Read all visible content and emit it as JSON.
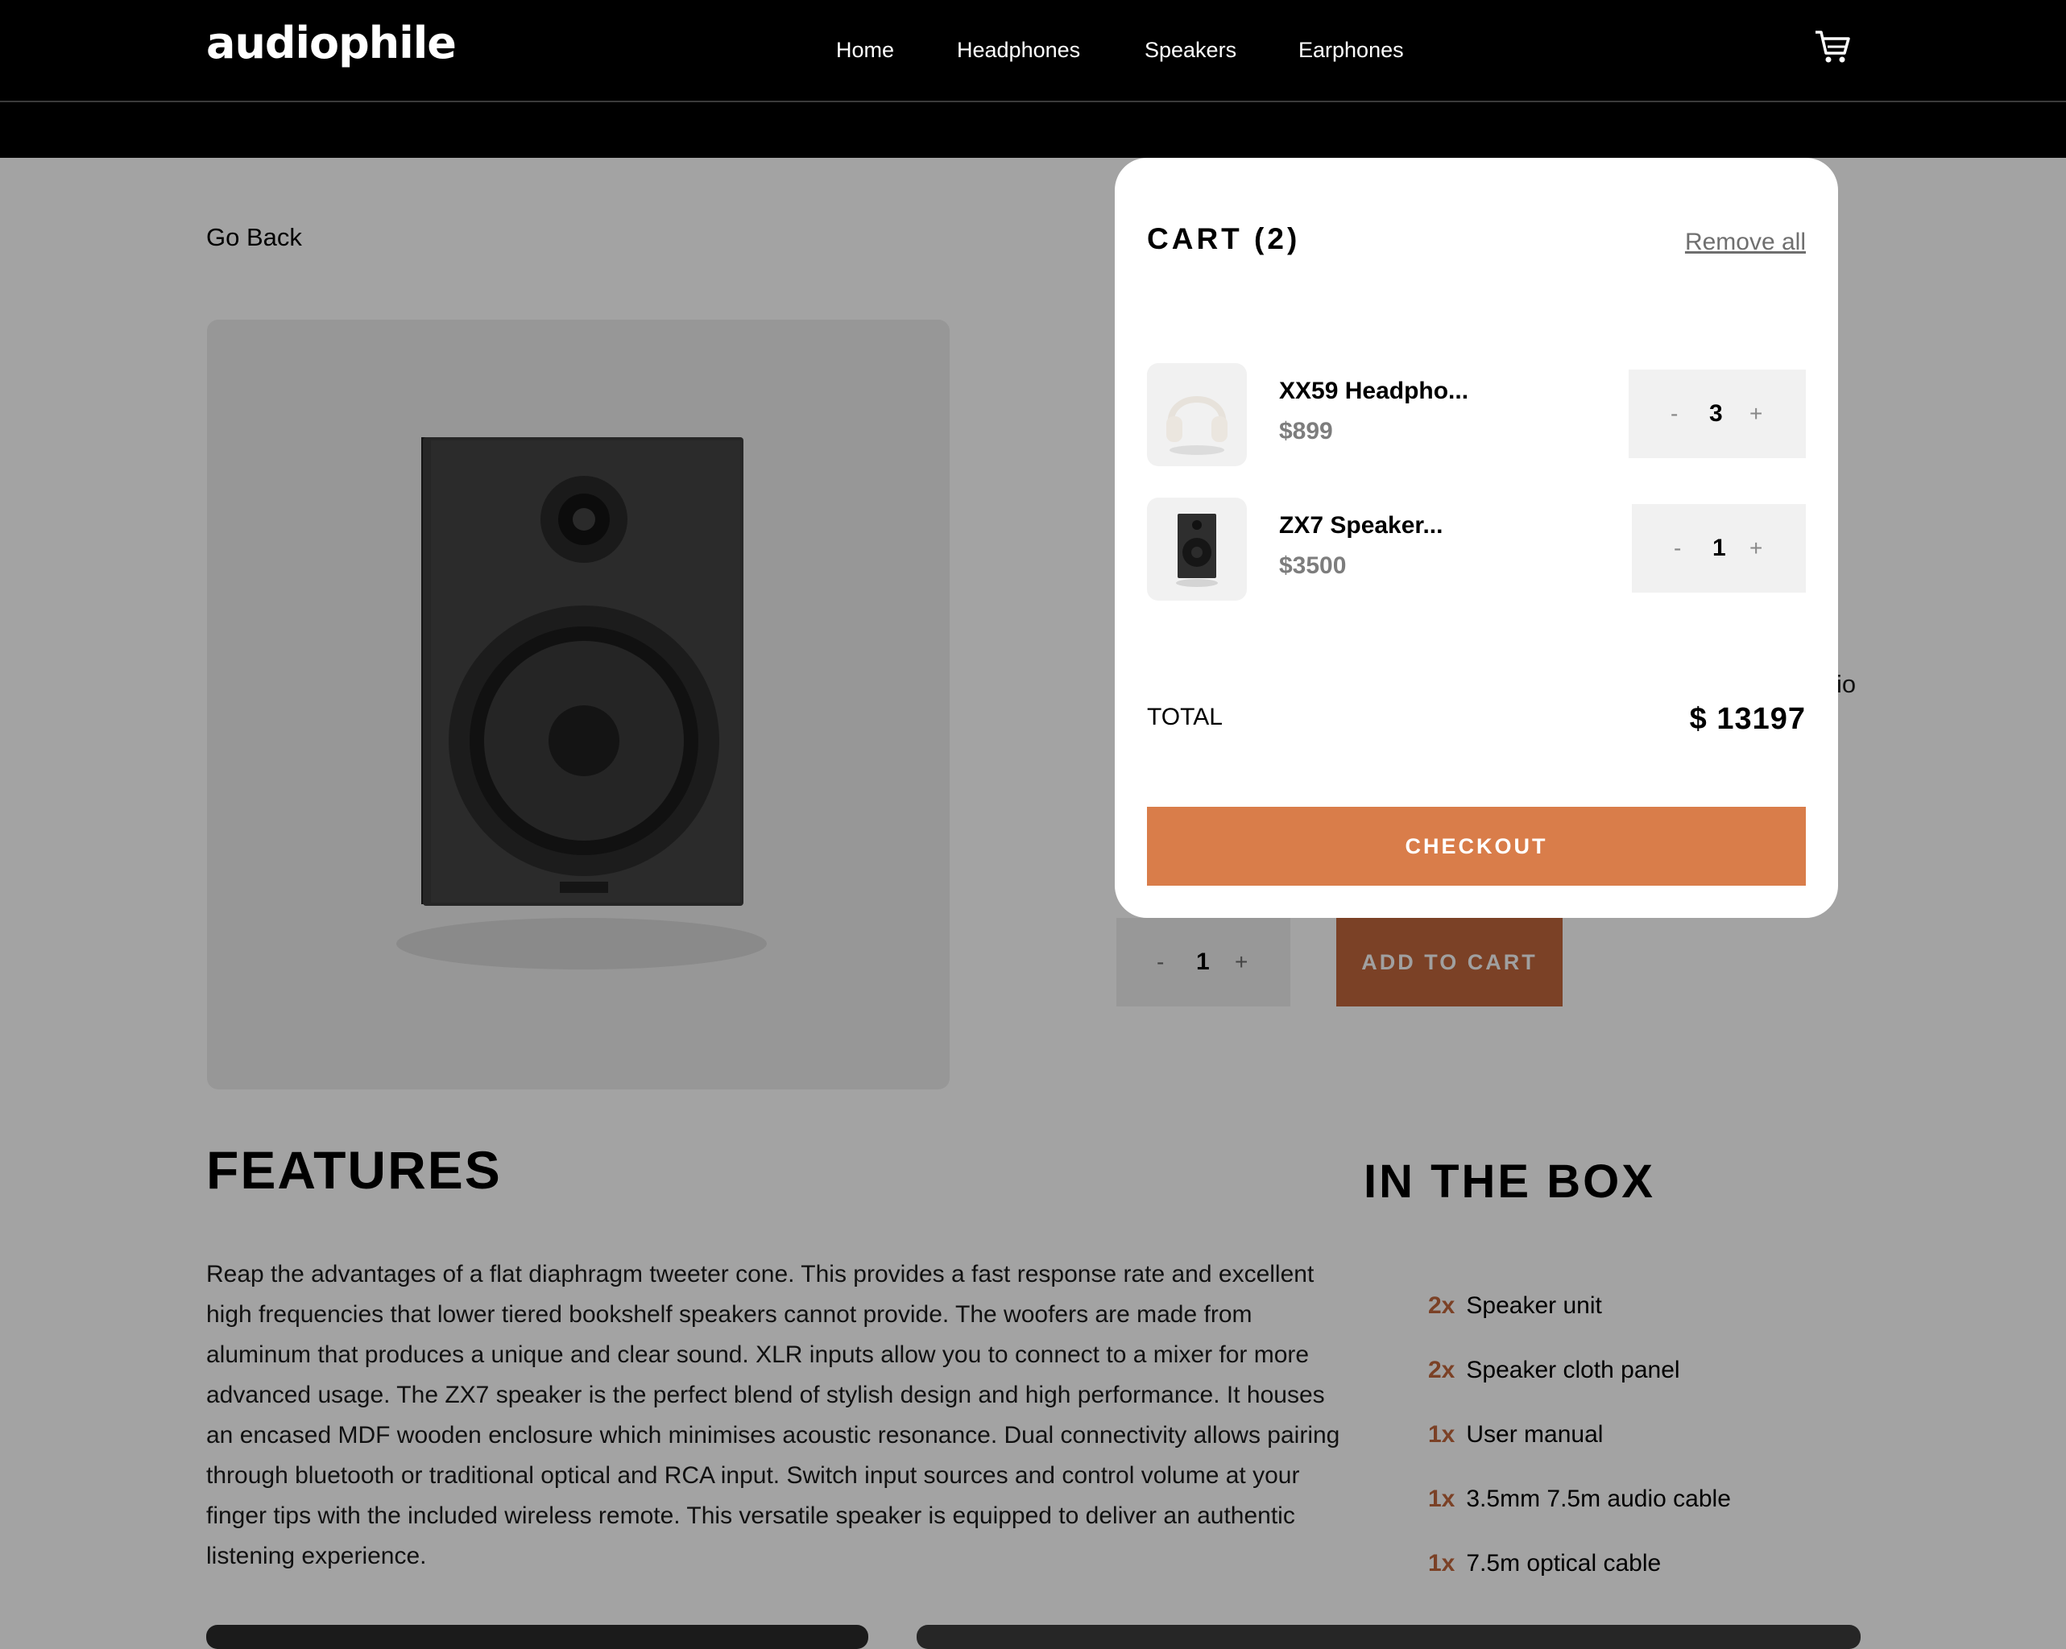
{
  "header": {
    "logo": "audiophile",
    "nav": [
      "Home",
      "Headphones",
      "Speakers",
      "Earphones"
    ]
  },
  "page": {
    "go_back": "Go Back",
    "partial_text": "io",
    "quantity": "1",
    "minus": "-",
    "plus": "+",
    "add_to_cart": "ADD TO CART",
    "features_title": "FEATURES",
    "features_text": "Reap the advantages of a flat diaphragm tweeter cone. This provides a fast response rate and excellent high frequencies that lower tiered bookshelf speakers cannot provide. The woofers are made from aluminum that produces a unique and clear sound. XLR inputs allow you to connect to a mixer for more advanced usage. The ZX7 speaker is the perfect blend of stylish design and high performance. It houses an encased MDF wooden enclosure which minimises acoustic resonance. Dual connectivity allows pairing through bluetooth or traditional optical and RCA input. Switch input sources and control volume at your finger tips with the included wireless remote. This versatile speaker is equipped to deliver an authentic listening experience.",
    "in_the_box_title": "IN THE BOX",
    "in_the_box": [
      {
        "qty": "2x",
        "item": "Speaker unit"
      },
      {
        "qty": "2x",
        "item": "Speaker cloth panel"
      },
      {
        "qty": "1x",
        "item": "User manual"
      },
      {
        "qty": "1x",
        "item": "3.5mm 7.5m audio cable"
      },
      {
        "qty": "1x",
        "item": "7.5m optical cable"
      }
    ]
  },
  "cart": {
    "title": "CART (2)",
    "remove_all": "Remove all",
    "items": [
      {
        "name": "XX59 Headpho...",
        "price": "$899",
        "qty": "3",
        "minus": "-",
        "plus": "+"
      },
      {
        "name": "ZX7 Speaker...",
        "price": "$3500",
        "qty": "1",
        "minus": "-",
        "plus": "+"
      }
    ],
    "total_label": "TOTAL",
    "total_value": "$ 13197",
    "checkout": "CHECKOUT"
  },
  "colors": {
    "accent": "#d87d4a",
    "accent_dimmed": "#7b4126",
    "overlay_bg": "#a3a3a3",
    "header_bg": "#000000"
  }
}
